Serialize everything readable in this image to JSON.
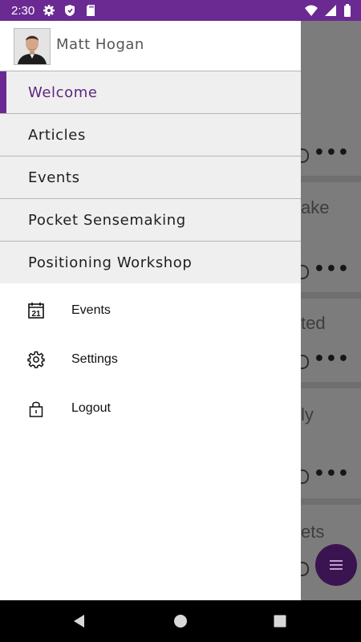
{
  "status_bar": {
    "time": "2:30",
    "left_icons": [
      "gear-icon",
      "shield-icon",
      "sd-card-icon"
    ],
    "right_icons": [
      "wifi-icon",
      "signal-icon",
      "battery-icon"
    ],
    "color": "#6a2a92"
  },
  "profile": {
    "name": "Matt Hogan"
  },
  "drawer_menu": {
    "items": [
      {
        "label": "Welcome",
        "active": true
      },
      {
        "label": "Articles",
        "active": false
      },
      {
        "label": "Events",
        "active": false
      },
      {
        "label": "Pocket Sensemaking",
        "active": false
      },
      {
        "label": "Positioning Workshop",
        "active": false
      }
    ],
    "accent_color": "#6a2a92"
  },
  "drawer_nav": {
    "items": [
      {
        "label": "Events",
        "icon": "calendar-icon",
        "icon_text": "21"
      },
      {
        "label": "Settings",
        "icon": "gear-icon"
      },
      {
        "label": "Logout",
        "icon": "lock-icon"
      }
    ]
  },
  "background_fragments": [
    {
      "text": "",
      "more": "•••"
    },
    {
      "text": "ake",
      "more": "•••"
    },
    {
      "text": "ted",
      "more": "•••"
    },
    {
      "text": "ly",
      "more": "•••"
    },
    {
      "text": "ets",
      "more": ""
    }
  ],
  "fab": {
    "icon": "menu-icon"
  },
  "system_nav": {
    "buttons": [
      "back-icon",
      "home-icon",
      "recents-icon"
    ]
  }
}
